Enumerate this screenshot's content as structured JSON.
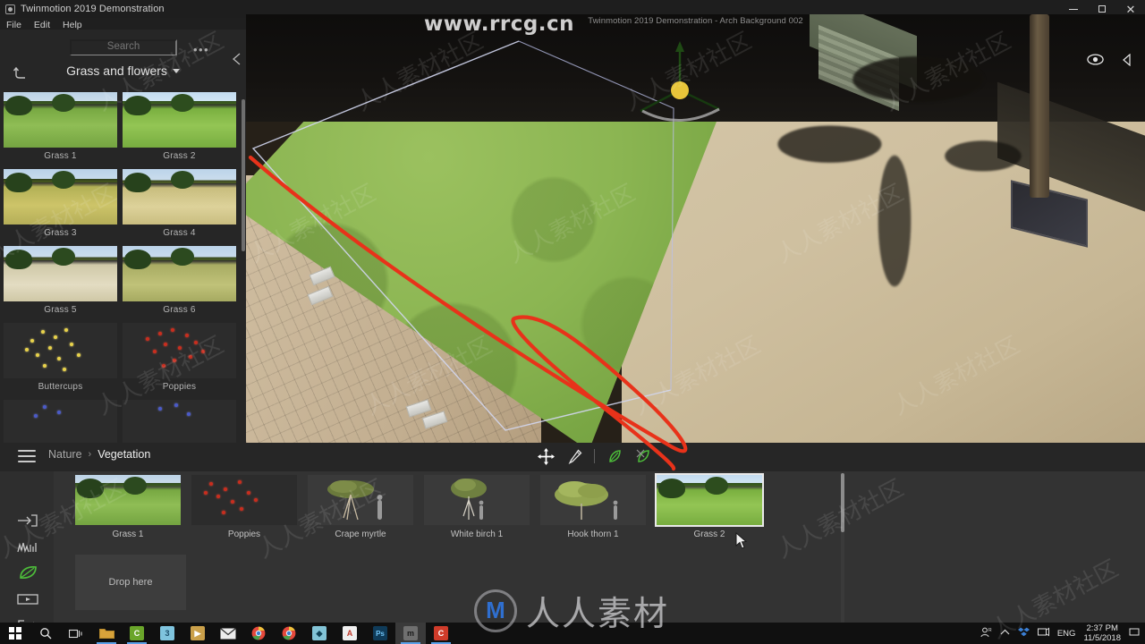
{
  "window": {
    "app_icon": "app-window-icon",
    "title": "Twinmotion 2019 Demonstration",
    "minimize": "—",
    "maximize": "□",
    "close": "✕"
  },
  "menubar": {
    "items": [
      {
        "label": "File"
      },
      {
        "label": "Edit"
      },
      {
        "label": "Help"
      }
    ]
  },
  "library": {
    "search_placeholder": "Search",
    "search_value": "",
    "overflow_label": "•••",
    "back_icon": "back-arrow-icon",
    "collapse_icon": "collapse-left-icon",
    "category": "Grass and flowers",
    "category_caret": "chevron-down-icon",
    "items": [
      {
        "label": "Grass 1",
        "art": "grass",
        "variant": "v1"
      },
      {
        "label": "Grass 2",
        "art": "grass",
        "variant": "v2"
      },
      {
        "label": "Grass 3",
        "art": "grass",
        "variant": "v3"
      },
      {
        "label": "Grass 4",
        "art": "grass",
        "variant": "v4"
      },
      {
        "label": "Grass 5",
        "art": "grass",
        "variant": "v5"
      },
      {
        "label": "Grass 6",
        "art": "grass",
        "variant": "v6"
      },
      {
        "label": "Buttercups",
        "art": "flowers",
        "variant": "yellow"
      },
      {
        "label": "Poppies",
        "art": "flowers",
        "variant": "red"
      },
      {
        "label": "",
        "art": "flowers",
        "variant": "blue"
      },
      {
        "label": "",
        "art": "flowers",
        "variant": "blue"
      }
    ]
  },
  "viewport": {
    "title": "Twinmotion 2019 Demonstration - Arch Background 002",
    "eye_icon": "eye-icon",
    "collapse_icon": "collapse-left-icon",
    "gizmo_icon": "move-gizmo-icon"
  },
  "dockbar": {
    "hamburger_icon": "hamburger-menu-icon",
    "breadcrumb": {
      "root": "Nature",
      "separator": "›",
      "current": "Vegetation"
    },
    "tools": [
      {
        "name": "move-tool-icon",
        "label": "move"
      },
      {
        "name": "paint-brush-tool-icon",
        "label": "paint"
      },
      {
        "name": "divider",
        "label": ""
      },
      {
        "name": "add-vegetation-icon",
        "label": "add"
      },
      {
        "name": "remove-vegetation-icon",
        "label": "remove"
      }
    ]
  },
  "dock": {
    "rail": [
      {
        "name": "sidebar-item-import",
        "icon": "import-icon",
        "active": false
      },
      {
        "name": "sidebar-item-weather",
        "icon": "weather-graph-icon",
        "active": false
      },
      {
        "name": "sidebar-item-vegetation",
        "icon": "leaf-icon",
        "active": true
      },
      {
        "name": "sidebar-item-media",
        "icon": "media-clip-icon",
        "active": false
      },
      {
        "name": "sidebar-item-export",
        "icon": "export-icon",
        "active": false
      }
    ],
    "shelf": [
      {
        "label": "Grass 1",
        "art": "grass",
        "variant": "v1",
        "selected": false
      },
      {
        "label": "Poppies",
        "art": "flowers",
        "variant": "red",
        "selected": false
      },
      {
        "label": "Crape myrtle",
        "art": "tree",
        "variant": "crape",
        "selected": false
      },
      {
        "label": "White birch 1",
        "art": "tree",
        "variant": "birch",
        "selected": false
      },
      {
        "label": "Hook thorn 1",
        "art": "tree",
        "variant": "thorn",
        "selected": false
      },
      {
        "label": "Grass 2",
        "art": "grass",
        "variant": "v2",
        "selected": true
      }
    ],
    "drop_zone_label": "Drop here"
  },
  "watermarks": {
    "url": "www.rrcg.cn",
    "brand_text": "人人素材",
    "brand_logo": "M",
    "tiles": "人人素材社区"
  },
  "taskbar": {
    "items": [
      {
        "name": "start-button",
        "icon": "windows-logo-icon",
        "running": false
      },
      {
        "name": "search-button",
        "icon": "search-icon",
        "running": false
      },
      {
        "name": "task-view-button",
        "icon": "task-view-icon",
        "running": false
      },
      {
        "name": "file-explorer-button",
        "icon": "folder-icon",
        "running": true,
        "color": "#d8a33a"
      },
      {
        "name": "app-button-c-green",
        "icon": "c-green-icon",
        "running": true,
        "color": "#6aa52a"
      },
      {
        "name": "app-button-3ds",
        "icon": "3ds-max-icon",
        "running": false,
        "color": "#3b8fc4"
      },
      {
        "name": "app-button-media",
        "icon": "media-player-icon",
        "running": false,
        "color": "#c9922f"
      },
      {
        "name": "app-button-mail",
        "icon": "mail-icon",
        "running": false,
        "color": "#e8e8e8"
      },
      {
        "name": "app-button-chrome-1",
        "icon": "chrome-icon",
        "running": false,
        "color": "#4a90d9"
      },
      {
        "name": "app-button-chrome-2",
        "icon": "chrome-icon",
        "running": false,
        "color": "#4a90d9"
      },
      {
        "name": "app-button-sketchup",
        "icon": "sketchup-icon",
        "running": false,
        "color": "#4e9fbf"
      },
      {
        "name": "app-button-autocad",
        "icon": "autocad-icon",
        "running": false,
        "color": "#c0392b"
      },
      {
        "name": "app-button-photoshop",
        "icon": "photoshop-icon",
        "running": false,
        "color": "#1b5c8a"
      },
      {
        "name": "app-button-twinmotion",
        "icon": "twinmotion-icon",
        "running": true,
        "color": "#8f8f8f",
        "active": true
      },
      {
        "name": "app-button-c-red",
        "icon": "c-red-icon",
        "running": true,
        "color": "#cf3b2a"
      }
    ],
    "tray": {
      "user_icon": "person-icon",
      "chevron_icon": "show-hidden-icons-icon",
      "dropbox_icon": "dropbox-icon",
      "network_icon": "network-icon",
      "language": "ENG",
      "time": "2:37 PM",
      "date": "11/5/2018",
      "notifications_icon": "notification-icon"
    }
  }
}
